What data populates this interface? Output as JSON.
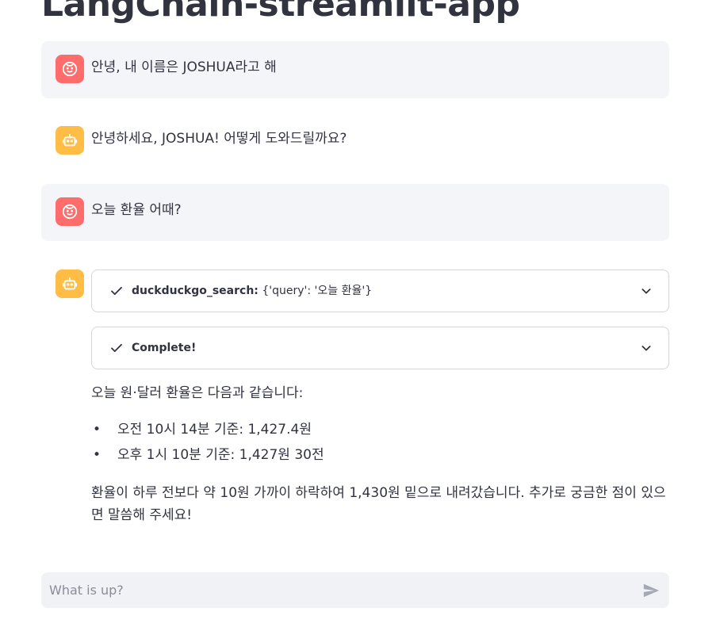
{
  "app": {
    "title": "LangChain-streamlit-app"
  },
  "messages": [
    {
      "role": "user",
      "text": "안녕, 내 이름은 JOSHUA라고 해"
    },
    {
      "role": "assistant",
      "text": "안녕하세요, JOSHUA! 어떻게 도와드릴까요?"
    },
    {
      "role": "user",
      "text": "오늘 환율 어때?"
    }
  ],
  "assistant_reply": {
    "steps": [
      {
        "tool": "duckduckgo_search:",
        "input": "{'query': '오늘 환율'}",
        "status_icon": "check-icon"
      },
      {
        "tool": "Complete!",
        "input": "",
        "status_icon": "check-icon"
      }
    ],
    "intro": "오늘 원·달러 환율은 다음과 같습니다:",
    "bullets": [
      "오전 10시 14분 기준: 1,427.4원",
      "오후 1시 10분 기준: 1,427원 30전"
    ],
    "closing": "환율이 하루 전보다 약 10원 가까이 하락하여 1,430원 밑으로 내려갔습니다. 추가로 궁금한 점이 있으면 말씀해 주세요!"
  },
  "chat_input": {
    "placeholder": "What is up?"
  },
  "colors": {
    "user_avatar": "#ff6c6c",
    "assistant_avatar": "#ffbd45",
    "user_bubble": "#f0f2f6",
    "text": "#31333f"
  }
}
